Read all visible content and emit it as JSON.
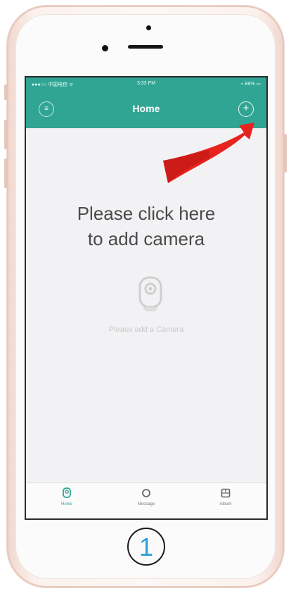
{
  "status_bar": {
    "carrier": "●●●○○ 中国电信 ᯤ",
    "time": "3:33 PM",
    "battery": "⌁ 86% ▭"
  },
  "nav": {
    "title": "Home",
    "left_icon": "menu-icon",
    "right_icon": "add-icon"
  },
  "instruction": {
    "line1": "Please click here",
    "line2": "to add camera"
  },
  "empty_state": {
    "icon": "camera-icon",
    "text": "Please add a Camera"
  },
  "tabs": [
    {
      "label": "Home",
      "icon": "camera-icon",
      "active": true
    },
    {
      "label": "Message",
      "icon": "message-icon",
      "active": false
    },
    {
      "label": "Album",
      "icon": "album-icon",
      "active": false
    }
  ],
  "home_button": {
    "label": "1"
  },
  "colors": {
    "header": "#31a593",
    "arrow": "#e8221d",
    "active_tab": "#31a593"
  }
}
